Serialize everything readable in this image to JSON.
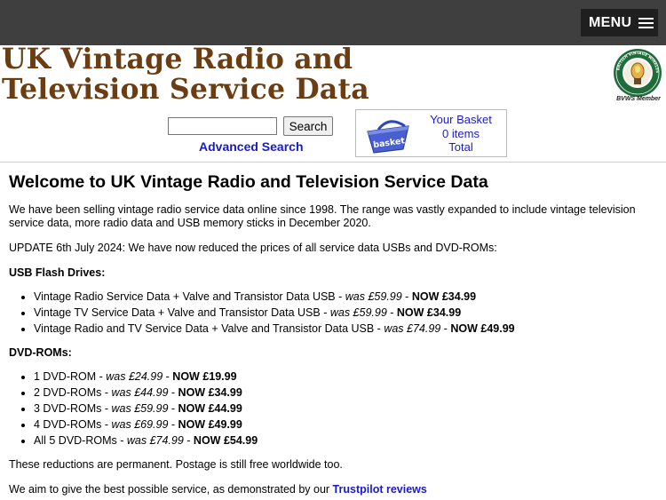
{
  "header": {
    "menu_label": "MENU",
    "title_line1": "UK Vintage Radio and",
    "title_line2": "Television Service Data",
    "badge_caption": "BVWS Member",
    "badge_ring_text": "BRITISH VINTAGE WIRELESS SOCIETY"
  },
  "search": {
    "value": "",
    "placeholder": "",
    "button_label": "Search",
    "advanced_label": "Advanced Search"
  },
  "basket": {
    "icon_label": "basket",
    "title": "Your Basket",
    "items": "0 items",
    "total": "Total"
  },
  "main": {
    "heading": "Welcome to UK Vintage Radio and Television Service Data",
    "intro": "We have been selling vintage radio service data online since 1998. The range was vastly expanded to include vintage television service data, more radio data and USB memory sticks in December 2020.",
    "update": "UPDATE 6th July 2024: We have now reduced the prices of all service data USBs and DVD-ROMs:",
    "usb_heading": "USB Flash Drives:",
    "usb_items": [
      {
        "name": "Vintage Radio Service Data + Valve and Transistor Data USB - ",
        "was": "was £59.99",
        "sep": " - ",
        "now": "NOW £34.99"
      },
      {
        "name": "Vintage TV Service Data + Valve and Transistor Data USB - ",
        "was": "was £59.99",
        "sep": " - ",
        "now": "NOW £34.99"
      },
      {
        "name": "Vintage Radio and TV Service Data + Valve and Transistor Data USB - ",
        "was": "was £74.99",
        "sep": " - ",
        "now": "NOW £49.99"
      }
    ],
    "dvd_heading": "DVD-ROMs:",
    "dvd_items": [
      {
        "name": "1 DVD-ROM - ",
        "was": "was £24.99",
        "sep": " - ",
        "now": "NOW £19.99"
      },
      {
        "name": "2 DVD-ROMs - ",
        "was": "was £44.99",
        "sep": " - ",
        "now": "NOW £34.99"
      },
      {
        "name": "3 DVD-ROMs - ",
        "was": "was £59.99",
        "sep": " - ",
        "now": "NOW £44.99"
      },
      {
        "name": "4 DVD-ROMs - ",
        "was": "was £69.99",
        "sep": " - ",
        "now": "NOW £49.99"
      },
      {
        "name": "All 5 DVD-ROMs - ",
        "was": "was £74.99",
        "sep": " - ",
        "now": "NOW £54.99"
      }
    ],
    "permanent": "These reductions are permanent. Postage is still free worldwide too.",
    "service_text": "We aim to give the best possible service, as demonstrated by our ",
    "trustpilot_link": "Trustpilot reviews"
  },
  "colors": {
    "topbar": "#3f3f3f",
    "title_brown": "#6b3d12",
    "link_blue": "#1a1acc",
    "basket_blue": "#4a5fd0"
  }
}
